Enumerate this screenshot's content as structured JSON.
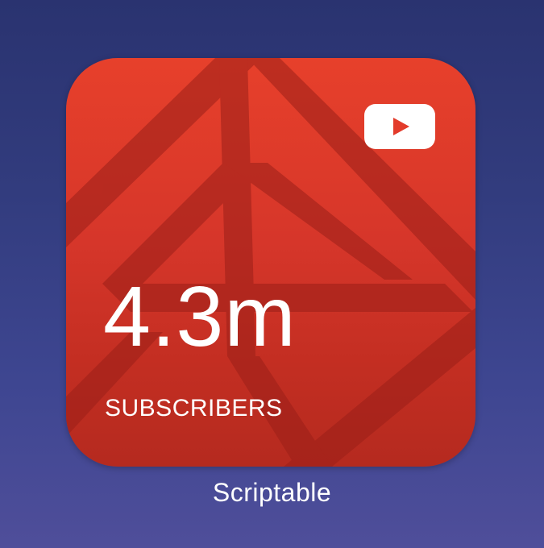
{
  "widget": {
    "count": "4.3m",
    "subtitle": "SUBSCRIBERS",
    "icon": "youtube-play-icon",
    "background_color": "#d6362a",
    "pattern_color": "#a8211a"
  },
  "app": {
    "label": "Scriptable"
  }
}
